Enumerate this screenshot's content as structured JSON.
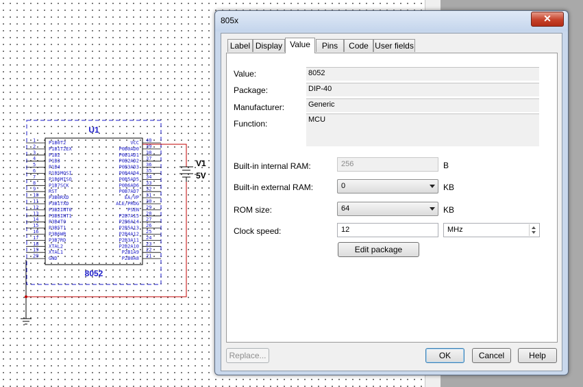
{
  "schematic": {
    "component_ref": "U1",
    "component_value": "8052",
    "source_ref": "V1",
    "source_value": "5V",
    "left_pins": [
      {
        "num": "1",
        "name": "P1B0T2"
      },
      {
        "num": "2",
        "name": "P1B1T2EX"
      },
      {
        "num": "3",
        "name": "P1B2"
      },
      {
        "num": "4",
        "name": "P1B3"
      },
      {
        "num": "5",
        "name": "P1B4"
      },
      {
        "num": "6",
        "name": "P1B5MOSI"
      },
      {
        "num": "7",
        "name": "P1B6MISO"
      },
      {
        "num": "8",
        "name": "P1B7SCK"
      },
      {
        "num": "9",
        "name": "RST"
      },
      {
        "num": "10",
        "name": "P3B0RXD"
      },
      {
        "num": "11",
        "name": "P3B1TXD"
      },
      {
        "num": "12",
        "name": "P3B2INT0"
      },
      {
        "num": "13",
        "name": "P3B3INT1"
      },
      {
        "num": "14",
        "name": "P3B4T0"
      },
      {
        "num": "15",
        "name": "P3B5T1"
      },
      {
        "num": "16",
        "name": "P3B6WR"
      },
      {
        "num": "17",
        "name": "P3B7RD"
      },
      {
        "num": "18",
        "name": "XTAL2"
      },
      {
        "num": "19",
        "name": "XTAL1"
      },
      {
        "num": "20",
        "name": "GND"
      }
    ],
    "right_pins": [
      {
        "num": "40",
        "name": "VCC"
      },
      {
        "num": "39",
        "name": "P0B0AD0"
      },
      {
        "num": "38",
        "name": "P0B1AD1"
      },
      {
        "num": "37",
        "name": "P0B2AD2"
      },
      {
        "num": "36",
        "name": "P0B3AD3"
      },
      {
        "num": "35",
        "name": "P0B4AD4"
      },
      {
        "num": "34",
        "name": "P0B5AD5"
      },
      {
        "num": "33",
        "name": "P0B6AD6"
      },
      {
        "num": "32",
        "name": "P0B7AD7"
      },
      {
        "num": "31",
        "name": "EA/VP"
      },
      {
        "num": "30",
        "name": "ALE/PROG"
      },
      {
        "num": "29",
        "name": "PSEN"
      },
      {
        "num": "28",
        "name": "P2B7A15"
      },
      {
        "num": "27",
        "name": "P2B6A14"
      },
      {
        "num": "26",
        "name": "P2B5A13"
      },
      {
        "num": "25",
        "name": "P2B4A12"
      },
      {
        "num": "24",
        "name": "P2B3A11"
      },
      {
        "num": "23",
        "name": "P2B2A10"
      },
      {
        "num": "22",
        "name": "P2B1A9"
      },
      {
        "num": "21",
        "name": "P2B0A8"
      }
    ]
  },
  "dialog": {
    "title": "805x",
    "close_label": "✕",
    "tabs": [
      {
        "label": "Label"
      },
      {
        "label": "Display"
      },
      {
        "label": "Value"
      },
      {
        "label": "Pins"
      },
      {
        "label": "Code"
      },
      {
        "label": "User fields"
      }
    ],
    "active_tab": "Value",
    "fields": {
      "value_label": "Value:",
      "value": "8052",
      "package_label": "Package:",
      "package": "DIP-40",
      "manufacturer_label": "Manufacturer:",
      "manufacturer": "Generic",
      "function_label": "Function:",
      "function": "MCU",
      "internal_ram_label": "Built-in internal RAM:",
      "internal_ram": "256",
      "internal_ram_unit": "B",
      "external_ram_label": "Built-in external RAM:",
      "external_ram": "0",
      "external_ram_unit": "KB",
      "rom_label": "ROM size:",
      "rom": "64",
      "rom_unit": "KB",
      "clock_label": "Clock speed:",
      "clock": "12",
      "clock_unit": "MHz"
    },
    "buttons": {
      "edit_package": "Edit package",
      "replace": "Replace...",
      "ok": "OK",
      "cancel": "Cancel",
      "help": "Help"
    }
  },
  "colors": {
    "wire": "#c00000",
    "schematic_blue": "#1a1ac8",
    "window_frame": "#c9d8ec",
    "close_button": "#c6412a"
  }
}
